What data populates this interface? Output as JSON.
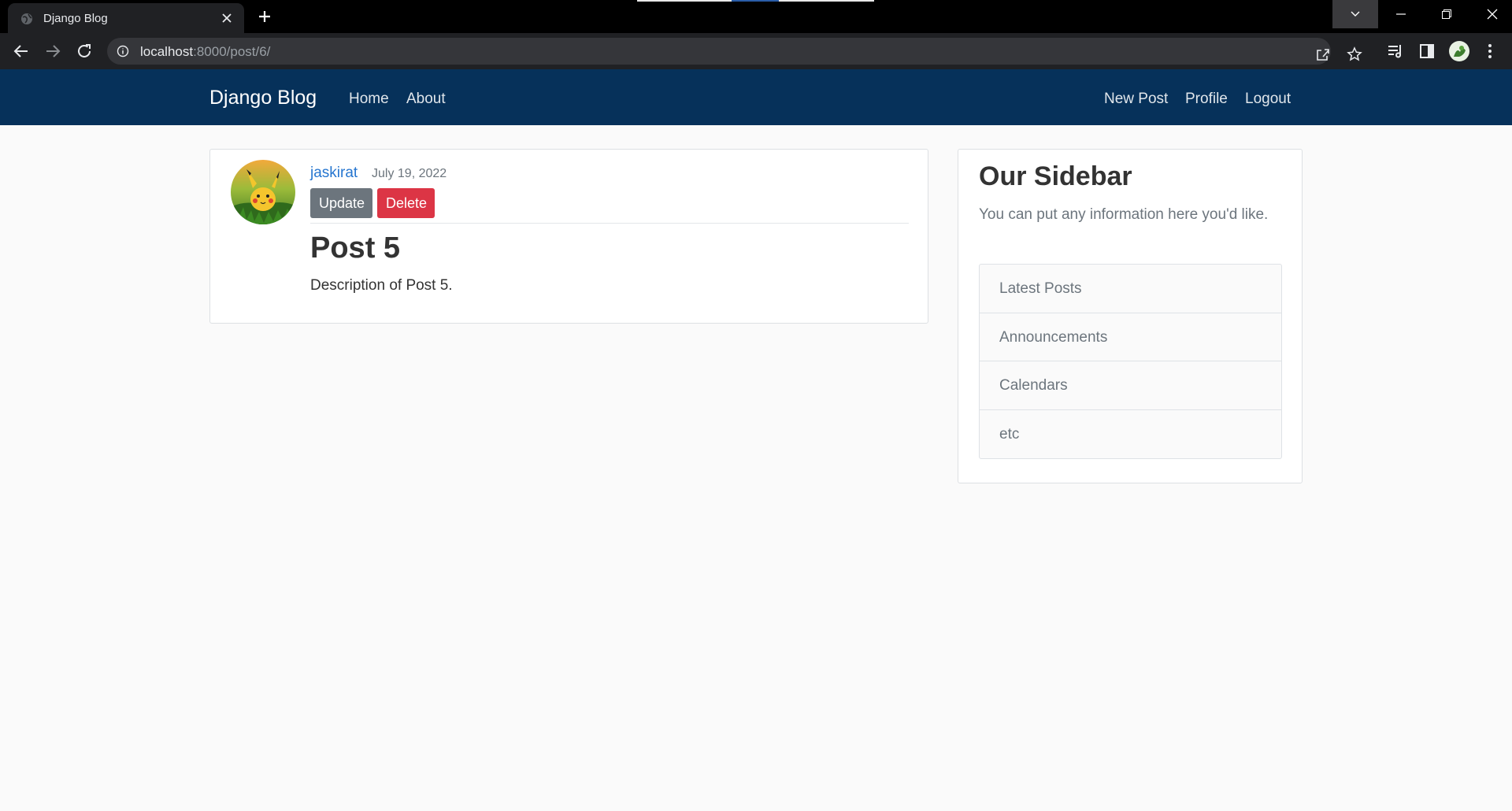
{
  "browser": {
    "tab_title": "Django Blog",
    "url_host": "localhost",
    "url_rest": ":8000/post/6/"
  },
  "navbar": {
    "brand": "Django Blog",
    "left_links": [
      "Home",
      "About"
    ],
    "right_links": [
      "New Post",
      "Profile",
      "Logout"
    ],
    "background": "#06315a"
  },
  "post": {
    "author": "jaskirat",
    "date": "July 19, 2022",
    "update_label": "Update",
    "delete_label": "Delete",
    "title": "Post 5",
    "content": "Description of Post 5."
  },
  "sidebar": {
    "title": "Our Sidebar",
    "description": "You can put any information here you'd like.",
    "items": [
      "Latest Posts",
      "Announcements",
      "Calendars",
      "etc"
    ]
  },
  "colors": {
    "link": "#2676d0",
    "update_button": "#6c757d",
    "delete_button": "#dc3545"
  }
}
